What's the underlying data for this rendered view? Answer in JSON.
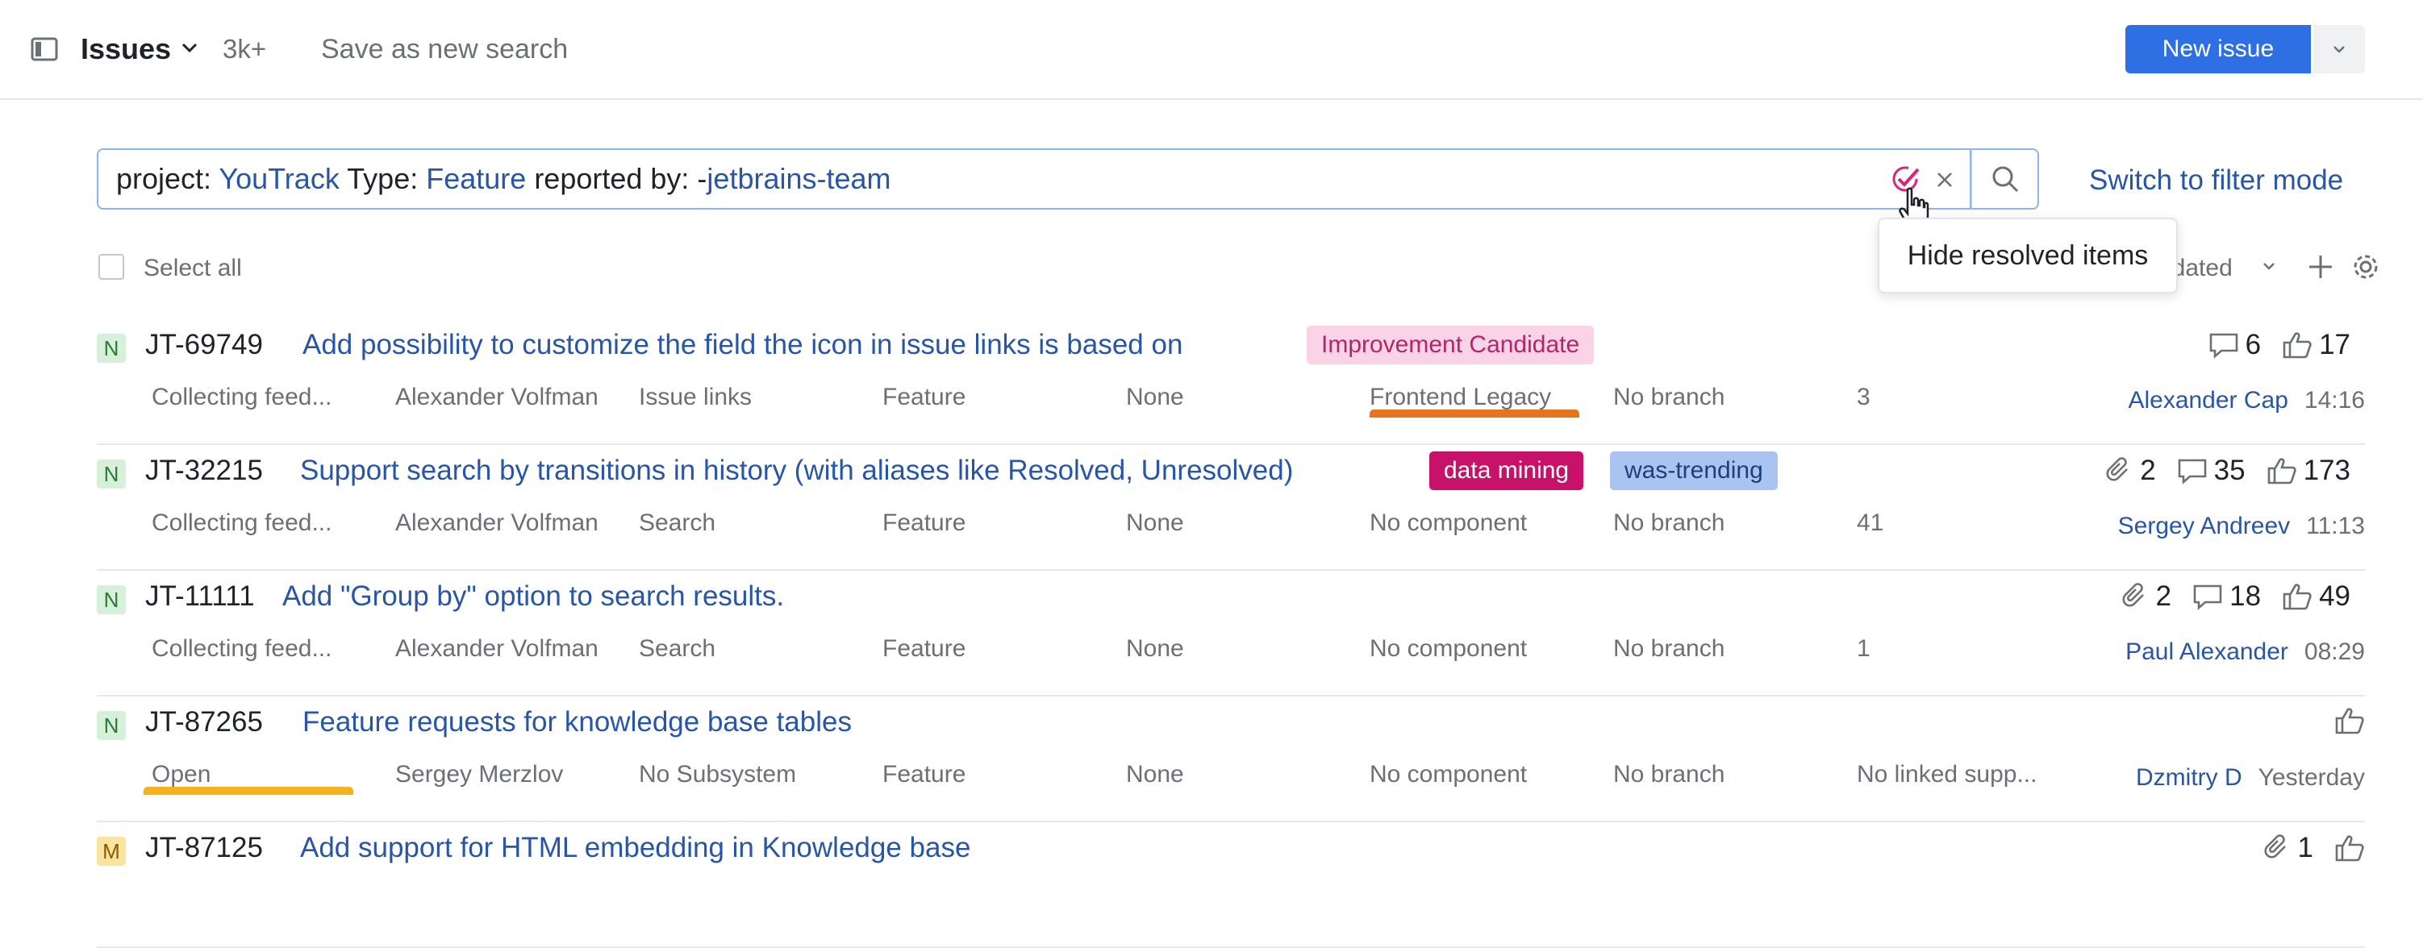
{
  "header": {
    "title": "Issues",
    "count": "3k+",
    "save_search": "Save as new search",
    "new_issue": "New issue"
  },
  "search": {
    "tokens": [
      {
        "text": "project: ",
        "kind": "plain"
      },
      {
        "text": "YouTrack",
        "kind": "value"
      },
      {
        "text": " Type: ",
        "kind": "plain"
      },
      {
        "text": "Feature",
        "kind": "value"
      },
      {
        "text": " reported by: -",
        "kind": "plain"
      },
      {
        "text": "jetbrains-team",
        "kind": "value"
      }
    ],
    "switch_mode": "Switch to filter mode",
    "tooltip": "Hide resolved items"
  },
  "list": {
    "select_all": "Select all",
    "sort_label": "odated"
  },
  "colors": {
    "accent": "#2f6fe4",
    "link": "#2855a6",
    "priority_normal_bg": "#d7f0d9",
    "priority_normal_fg": "#2b7a35",
    "priority_major_bg": "#fde3a0",
    "priority_major_fg": "#8a5a00"
  },
  "issues": [
    {
      "priority": "N",
      "id": "JT-69749",
      "title": "Add possibility to customize the field the icon in issue links is based on",
      "tags": [
        {
          "text": "Improvement Candidate",
          "bg": "#fbd3e6",
          "fg": "#b3246b"
        }
      ],
      "fields": [
        "Collecting feed...",
        "Alexander Volfman",
        "Issue links",
        "Feature",
        "None",
        "Frontend Legacy",
        "No branch",
        "3"
      ],
      "attachments": "",
      "comments": "6",
      "votes": "17",
      "assignee": "Alexander Cap",
      "time": "14:16"
    },
    {
      "priority": "N",
      "id": "JT-32215",
      "title": "Support search by transitions in history (with aliases like Resolved, Unresolved)",
      "tags": [
        {
          "text": "data mining",
          "bg": "#c8126a",
          "fg": "#ffffff"
        },
        {
          "text": "was-trending",
          "bg": "#a9c4f0",
          "fg": "#1f3f7a"
        }
      ],
      "fields": [
        "Collecting feed...",
        "Alexander Volfman",
        "Search",
        "Feature",
        "None",
        "No component",
        "No branch",
        "41"
      ],
      "attachments": "2",
      "comments": "35",
      "votes": "173",
      "assignee": "Sergey Andreev",
      "time": "11:13"
    },
    {
      "priority": "N",
      "id": "JT-11111",
      "title": "Add \"Group by\" option to search results.",
      "tags": [],
      "fields": [
        "Collecting feed...",
        "Alexander Volfman",
        "Search",
        "Feature",
        "None",
        "No component",
        "No branch",
        "1"
      ],
      "attachments": "2",
      "comments": "18",
      "votes": "49",
      "assignee": "Paul Alexander",
      "time": "08:29"
    },
    {
      "priority": "N",
      "id": "JT-87265",
      "title": "Feature requests for knowledge base tables",
      "tags": [],
      "fields": [
        "Open",
        "Sergey Merzlov",
        "No Subsystem",
        "Feature",
        "None",
        "No component",
        "No branch",
        "No linked supp..."
      ],
      "attachments": "",
      "comments": "",
      "votes": "",
      "assignee": "Dzmitry D",
      "time": "Yesterday"
    },
    {
      "priority": "M",
      "id": "JT-87125",
      "title": "Add support for HTML embedding in Knowledge base",
      "tags": [],
      "fields": [],
      "attachments": "1",
      "comments": "",
      "votes": "",
      "assignee": "",
      "time": ""
    }
  ]
}
